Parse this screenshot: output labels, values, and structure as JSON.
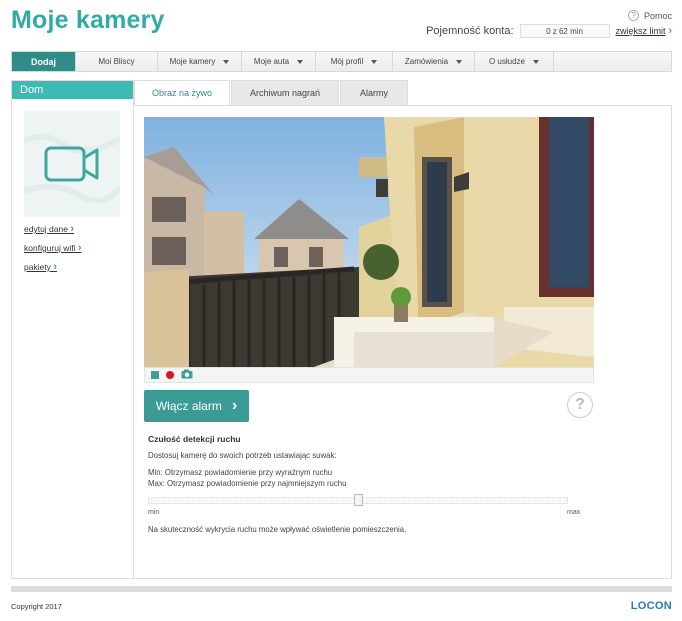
{
  "header": {
    "title": "Moje kamery",
    "help_label": "Pomoc",
    "capacity_label": "Pojemność konta:",
    "capacity_value": "0 z 62 min",
    "increase_link": "zwiększ limit"
  },
  "nav": {
    "items": [
      {
        "label": "Dodaj"
      },
      {
        "label": "Moi Bliscy"
      },
      {
        "label": "Moje kamery"
      },
      {
        "label": "Moje auta"
      },
      {
        "label": "Mój profil"
      },
      {
        "label": "Zamówienia"
      },
      {
        "label": "O usłudze"
      }
    ]
  },
  "sidebar": {
    "title": "Dom",
    "links": [
      {
        "label": "edytuj dane"
      },
      {
        "label": "konfiguruj wifi"
      },
      {
        "label": "pakiety"
      }
    ]
  },
  "tabs": [
    {
      "label": "Obraz na żywo"
    },
    {
      "label": "Archiwum nagrań"
    },
    {
      "label": "Alarmy"
    }
  ],
  "alarm_button": "Włącz alarm",
  "motion": {
    "title": "Czułość detekcji ruchu",
    "description": "Dostosuj kamerę do swoich potrzeb ustawiając suwak:",
    "min_text": "Min: Otrzymasz powiadomienie przy wyraźnym ruchu",
    "max_text": "Max: Otrzymasz powiadomienie przy najmniejszym ruchu",
    "slider_min": "min",
    "slider_max": "max",
    "slider_value": 0.5,
    "note": "Na skuteczność wykrycia ruchu może wpływać oświetlenie pomieszczenia."
  },
  "footer": {
    "copyright": "Copyright 2017",
    "logo": "LOCON"
  },
  "colors": {
    "accent": "#33aaa5",
    "active_nav": "#2f8c88",
    "record": "#d81818",
    "logo": "#2a7ab8"
  }
}
